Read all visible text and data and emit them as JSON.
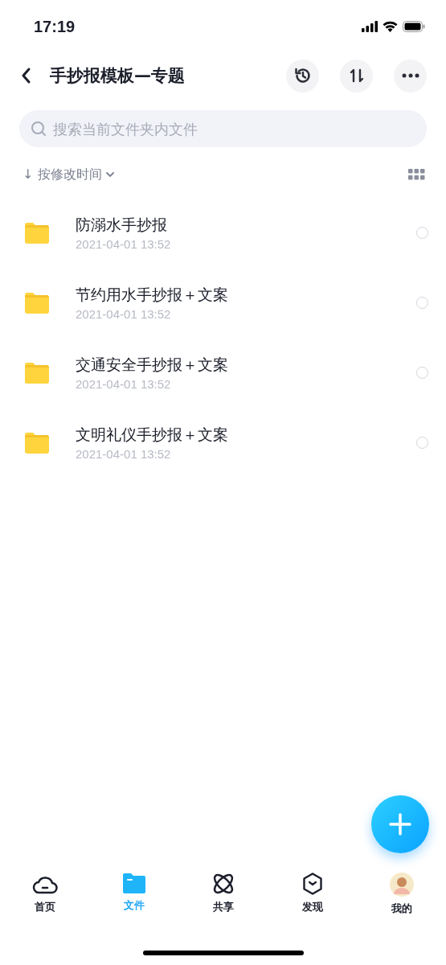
{
  "status_bar": {
    "time": "17:19"
  },
  "header": {
    "title": "手抄报模板—专题"
  },
  "search": {
    "placeholder": "搜索当前文件夹内文件"
  },
  "sort": {
    "arrow": "↓",
    "label": "按修改时间"
  },
  "files": [
    {
      "name": "防溺水手抄报",
      "date": "2021-04-01 13:52",
      "selected": false
    },
    {
      "name": "节约用水手抄报＋文案",
      "date": "2021-04-01 13:52",
      "selected": false
    },
    {
      "name": "交通安全手抄报＋文案",
      "date": "2021-04-01 13:52",
      "selected": false
    },
    {
      "name": "文明礼仪手抄报＋文案",
      "date": "2021-04-01 13:52",
      "selected": false
    }
  ],
  "tab_bar": [
    {
      "label": "首页",
      "kind": "cloud",
      "selected": false
    },
    {
      "label": "文件",
      "kind": "folder",
      "selected": true
    },
    {
      "label": "共享",
      "kind": "orbit",
      "selected": false
    },
    {
      "label": "发现",
      "kind": "cube",
      "selected": false
    },
    {
      "label": "我的",
      "kind": "avatar",
      "selected": false
    }
  ]
}
